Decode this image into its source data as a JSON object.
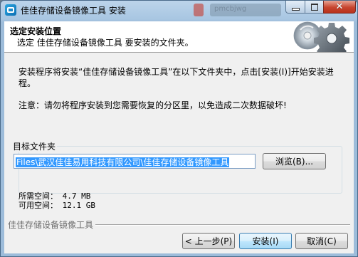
{
  "window": {
    "title": "佳佳存储设备镜像工具 安装",
    "background_text": "pmcbjwg"
  },
  "header": {
    "title": "选定安装位置",
    "subtitle": "选定 佳佳存储设备镜像工具 要安装的文件夹。"
  },
  "body": {
    "description": "安装程序将安装“佳佳存储设备镜像工具”在以下文件夹中，点击[安装(I)]开始安装进程。",
    "note": "注意：请勿将程序安装到您需要恢复的分区里，以免造成二次数据破坏!"
  },
  "target": {
    "group_label": "目标文件夹",
    "path_value": "Files\\武汉佳佳易用科技有限公司\\佳佳存储设备镜像工具",
    "browse_label": "浏览(B)..."
  },
  "space": {
    "required": "所需空间： 4.7 MB",
    "available": "可用空间： 12.1 GB"
  },
  "footer": {
    "brand": "佳佳存储设备镜像工具",
    "back_label": "< 上一步(P)",
    "install_label": "安装(I)",
    "cancel_label": "取消(C)"
  },
  "icons": {
    "app": "installer-app-icon",
    "header_art": "disc-and-gear-icon"
  }
}
